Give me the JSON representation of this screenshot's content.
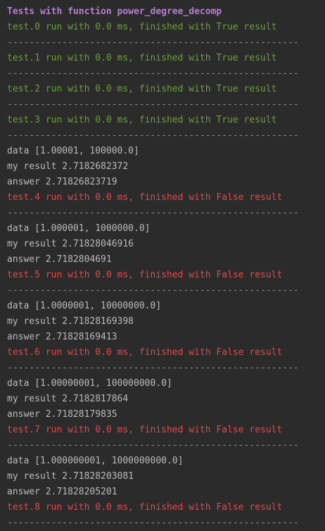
{
  "header": "Tests with function power_degree_decomp",
  "separator": "-----------------------------------------------------",
  "results": [
    {
      "type": "pass",
      "status": "test.0 run with 0.0 ms, finished with True result"
    },
    {
      "type": "pass",
      "status": "test.1 run with 0.0 ms, finished with True result"
    },
    {
      "type": "pass",
      "status": "test.2 run with 0.0 ms, finished with True result"
    },
    {
      "type": "pass",
      "status": "test.3 run with 0.0 ms, finished with True result"
    },
    {
      "type": "fail",
      "data": "data [1.00001, 100000.0]",
      "my_result": "my result 2.7182682372",
      "answer": "answer 2.71826823719",
      "status": "test.4 run with 0.0 ms, finished with False result"
    },
    {
      "type": "fail",
      "data": "data [1.000001, 1000000.0]",
      "my_result": "my result 2.71828046916",
      "answer": "answer 2.7182804691",
      "status": "test.5 run with 0.0 ms, finished with False result"
    },
    {
      "type": "fail",
      "data": "data [1.0000001, 10000000.0]",
      "my_result": "my result 2.71828169398",
      "answer": "answer 2.71828169413",
      "status": "test.6 run with 0.0 ms, finished with False result"
    },
    {
      "type": "fail",
      "data": "data [1.00000001, 100000000.0]",
      "my_result": "my result 2.7182817864",
      "answer": "answer 2.71828179835",
      "status": "test.7 run with 0.0 ms, finished with False result"
    },
    {
      "type": "fail",
      "data": "data [1.000000001, 1000000000.0]",
      "my_result": "my result 2.71828203081",
      "answer": "answer 2.71828205201",
      "status": "test.8 run with 0.0 ms, finished with False result"
    }
  ]
}
